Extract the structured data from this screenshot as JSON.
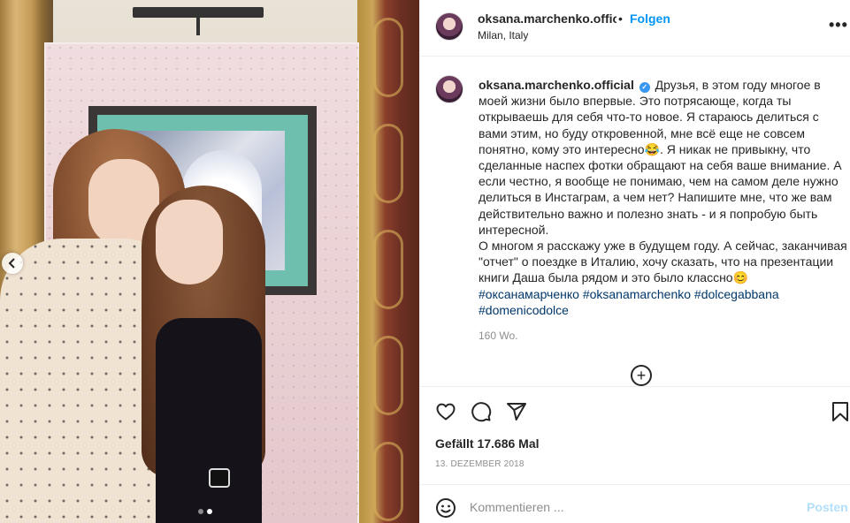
{
  "post": {
    "photo": {
      "prev_icon": "chevron-left-icon",
      "carousel": {
        "count": 2,
        "active": 1
      }
    },
    "header": {
      "username": "oksana.marchenko.official",
      "separator": "•",
      "follow_label": "Folgen",
      "location": "Milan, Italy",
      "more_icon": "more-horizontal-icon",
      "more_label": "•••"
    },
    "caption": {
      "username": "oksana.marchenko.official",
      "verified_icon": "verified-badge-icon",
      "verified_glyph": "✓",
      "text_1": "Друзья, в этом году многое в моей жизни было впервые. Это потрясающе, когда ты открываешь для себя что-то новое. Я стараюсь делиться с вами этим, но буду откровенной, мне всё еще не совсем понятно, кому это интересно",
      "emoji_1": "😂",
      "text_2": ". Я никак не привыкну, что сделанные наспех фотки обращают на себя ваше внимание. А если честно, я вообще не понимаю, чем на самом деле нужно делиться в Инстаграм, а чем нет? Напишите мне, что же вам действительно важно и полезно знать - и я попробую быть интересной.",
      "text_3": "О многом я расскажу уже в будущем году. А сейчас, заканчивая \"отчет\" о поездке в Италию, хочу сказать, что на презентации книги Даша была рядом и это было классно",
      "emoji_2": "😊",
      "hashtags": [
        "#оксанамарченко",
        "#oksanamarchenko",
        "#dolcegabbana",
        "#domenicodolce"
      ],
      "time_ago": "160 Wo."
    },
    "load_more_icon": "plus-circle-icon",
    "load_more_glyph": "+",
    "actions": {
      "like_icon": "heart-icon",
      "comment_icon": "comment-icon",
      "share_icon": "paper-plane-icon",
      "save_icon": "bookmark-icon"
    },
    "likes": "Gefällt 17.686 Mal",
    "date": "13. DEZEMBER 2018",
    "comment": {
      "emoji_icon": "smiley-icon",
      "placeholder": "Kommentieren ...",
      "value": "",
      "post_label": "Posten",
      "post_color": "#b2dffc"
    },
    "colors": {
      "accent": "#0095f6",
      "text": "#262626",
      "muted": "#8e8e8e",
      "hashtag": "#00376b",
      "divider": "#efefef"
    }
  }
}
